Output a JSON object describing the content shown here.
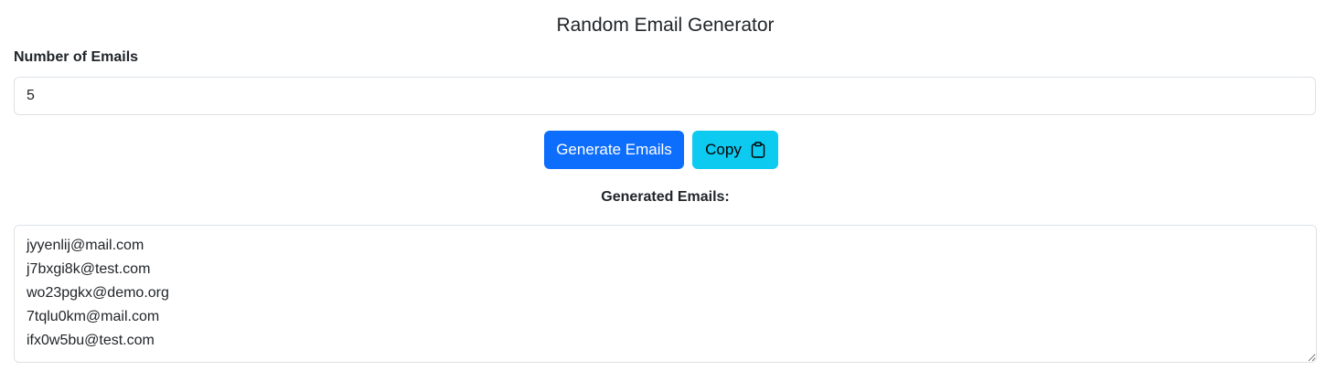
{
  "app": {
    "title": "Random Email Generator"
  },
  "form": {
    "count_label": "Number of Emails",
    "count_value": "5"
  },
  "actions": {
    "generate_label": "Generate Emails",
    "copy_label": "Copy",
    "copy_icon": "clipboard-icon"
  },
  "output": {
    "label": "Generated Emails:",
    "emails": [
      "jyyenlij@mail.com",
      "j7bxgi8k@test.com",
      "wo23pgkx@demo.org",
      "7tqlu0km@mail.com",
      "ifx0w5bu@test.com"
    ]
  },
  "colors": {
    "primary": "#0d6efd",
    "info": "#0dcaf0",
    "border": "#dee2e6",
    "text": "#212529"
  }
}
